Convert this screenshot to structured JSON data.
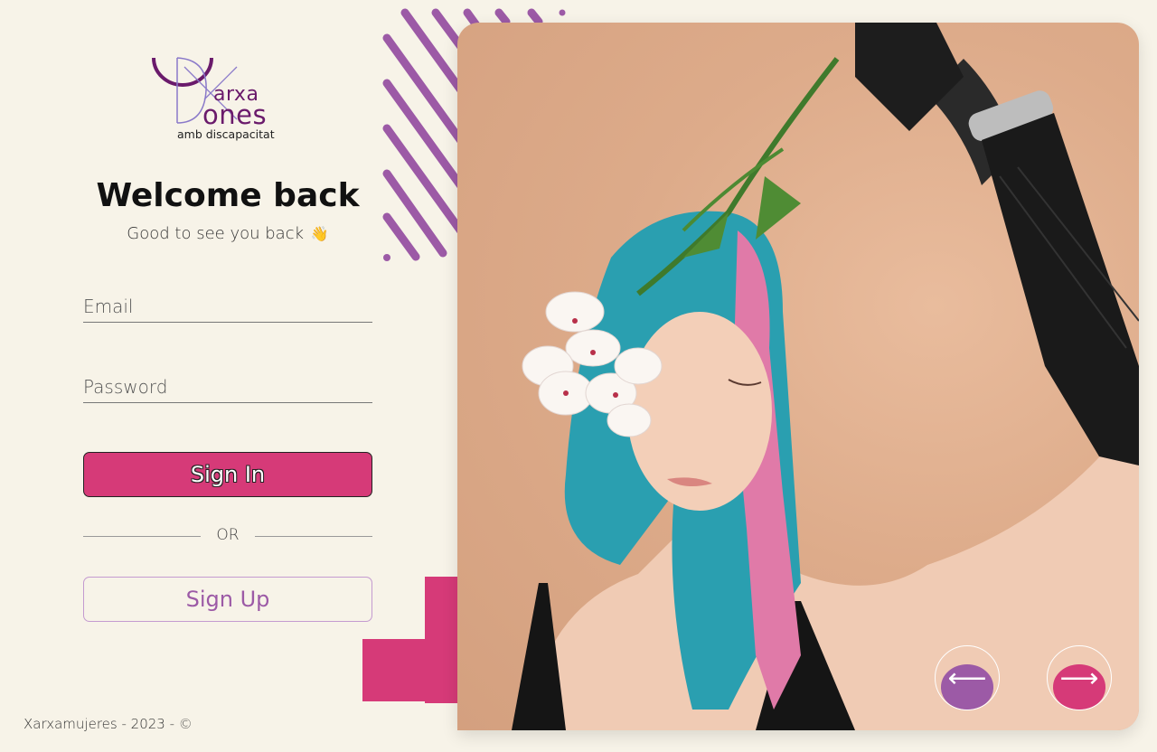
{
  "brand": {
    "logo_word1": "arxa",
    "logo_word2": "ones",
    "logo_tagline": "amb discapacitat",
    "primary_color": "#d63a78",
    "secondary_color": "#9c5aa6"
  },
  "login": {
    "title": "Welcome back",
    "subtitle": "Good to see you back",
    "subtitle_emoji": "👋",
    "email_placeholder": "Email",
    "password_placeholder": "Password",
    "signin_label": "Sign In",
    "or_label": "OR",
    "signup_label": "Sign Up"
  },
  "footer": {
    "text": "Xarxamujeres - 2023 - ©"
  },
  "carousel": {
    "prev_icon": "arrow-left-icon",
    "next_icon": "arrow-right-icon",
    "prev_glyph": "⟵",
    "next_glyph": "⟶"
  }
}
